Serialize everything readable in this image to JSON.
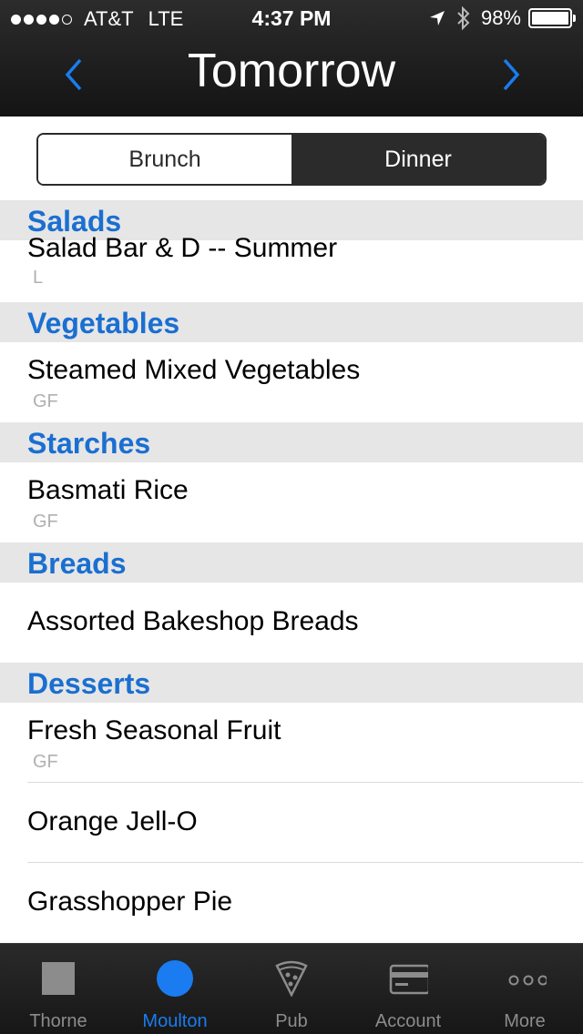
{
  "status_bar": {
    "carrier": "AT&T",
    "network": "LTE",
    "time": "4:37 PM",
    "battery": "98%",
    "battery_level": 0.98,
    "signal_bars_filled": 4,
    "signal_bars_total": 5
  },
  "nav": {
    "title": "Tomorrow",
    "prev_icon": "chevron-left-icon",
    "next_icon": "chevron-right-icon",
    "accent": "#1a7cf0"
  },
  "segment": {
    "options": [
      "Brunch",
      "Dinner"
    ],
    "selected": "Dinner"
  },
  "menu": {
    "sections": [
      {
        "title": "Salads",
        "items": [
          {
            "name": "Salad Bar  & D -- Summer",
            "tag": "L"
          }
        ]
      },
      {
        "title": "Vegetables",
        "items": [
          {
            "name": "Steamed Mixed Vegetables",
            "tag": "GF"
          }
        ]
      },
      {
        "title": "Starches",
        "items": [
          {
            "name": "Basmati Rice",
            "tag": "GF"
          }
        ]
      },
      {
        "title": "Breads",
        "items": [
          {
            "name": "Assorted Bakeshop Breads",
            "tag": ""
          }
        ]
      },
      {
        "title": "Desserts",
        "items": [
          {
            "name": "Fresh Seasonal  Fruit",
            "tag": "GF"
          },
          {
            "name": "Orange Jell-O",
            "tag": ""
          },
          {
            "name": "Grasshopper Pie",
            "tag": ""
          }
        ]
      }
    ]
  },
  "tabbar": {
    "tabs": [
      {
        "label": "Thorne",
        "icon": "square-icon"
      },
      {
        "label": "Moulton",
        "icon": "circle-icon"
      },
      {
        "label": "Pub",
        "icon": "pizza-icon"
      },
      {
        "label": "Account",
        "icon": "credit-card-icon"
      },
      {
        "label": "More",
        "icon": "more-icon"
      }
    ],
    "active": "Moulton"
  }
}
